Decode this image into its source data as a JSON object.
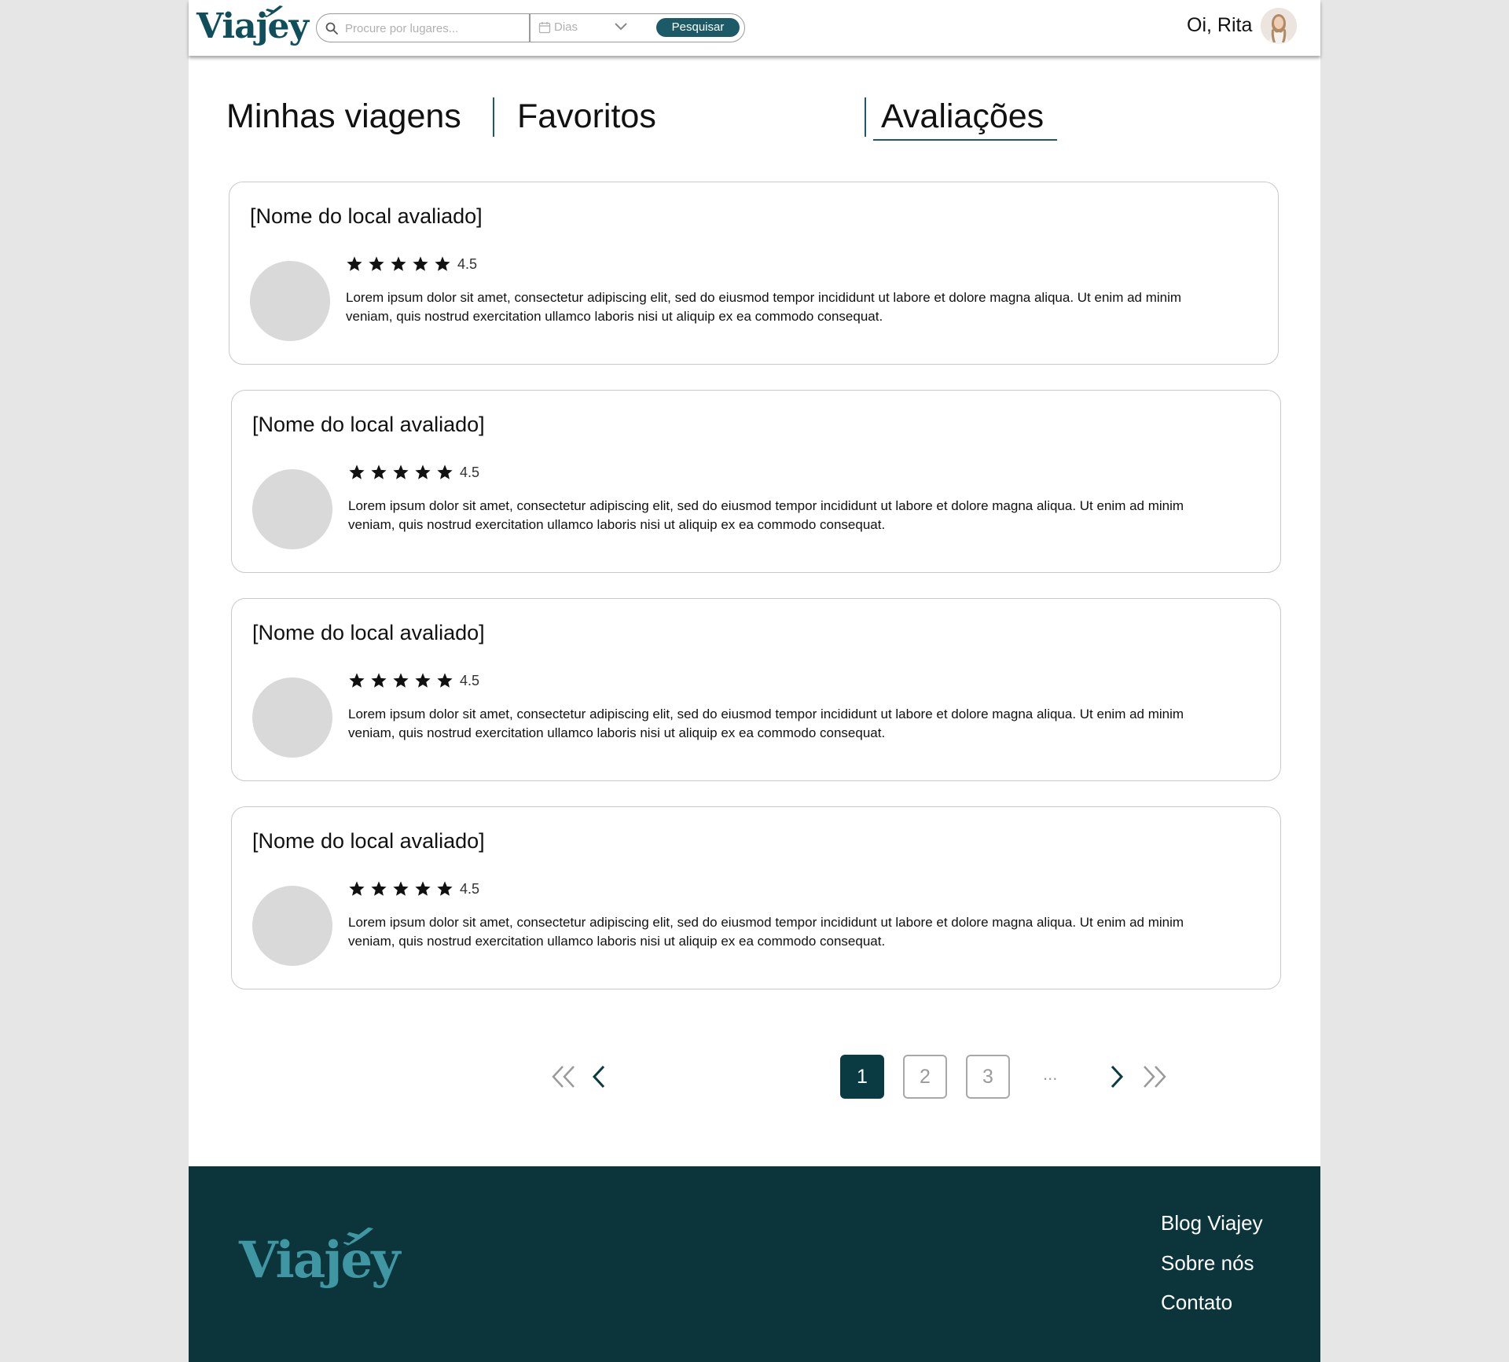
{
  "brand": {
    "name": "Viajey"
  },
  "header": {
    "search_placeholder": "Procure por lugares...",
    "days_label": "Dias",
    "search_button": "Pesquisar",
    "greeting": "Oi, Rita"
  },
  "tabs": [
    {
      "label": "Minhas viagens",
      "active": false
    },
    {
      "label": "Favoritos",
      "active": false
    },
    {
      "label": "Avaliações",
      "active": true
    }
  ],
  "reviews": [
    {
      "title": "[Nome do local avaliado]",
      "stars": 5,
      "rating": "4.5",
      "text": "Lorem ipsum dolor sit amet, consectetur adipiscing elit, sed do eiusmod tempor incididunt ut labore et dolore magna aliqua. Ut enim ad minim veniam, quis nostrud exercitation ullamco laboris nisi ut aliquip ex ea commodo consequat."
    },
    {
      "title": "[Nome do local avaliado]",
      "stars": 5,
      "rating": "4.5",
      "text": "Lorem ipsum dolor sit amet, consectetur adipiscing elit, sed do eiusmod tempor incididunt ut labore et dolore magna aliqua. Ut enim ad minim veniam, quis nostrud exercitation ullamco laboris nisi ut aliquip ex ea commodo consequat."
    },
    {
      "title": "[Nome do local avaliado]",
      "stars": 5,
      "rating": "4.5",
      "text": "Lorem ipsum dolor sit amet, consectetur adipiscing elit, sed do eiusmod tempor incididunt ut labore et dolore magna aliqua. Ut enim ad minim veniam, quis nostrud exercitation ullamco laboris nisi ut aliquip ex ea commodo consequat."
    },
    {
      "title": "[Nome do local avaliado]",
      "stars": 5,
      "rating": "4.5",
      "text": "Lorem ipsum dolor sit amet, consectetur adipiscing elit, sed do eiusmod tempor incididunt ut labore et dolore magna aliqua. Ut enim ad minim veniam, quis nostrud exercitation ullamco laboris nisi ut aliquip ex ea commodo consequat."
    }
  ],
  "pagination": {
    "pages": [
      "1",
      "2",
      "3"
    ],
    "current": "1",
    "ellipsis": "..."
  },
  "footer": {
    "links": [
      "Blog Viajey",
      "Sobre nós",
      "Contato"
    ]
  },
  "colors": {
    "brand_teal": "#0f4f5c",
    "button": "#1b5a66",
    "footer_bg": "#0b343b",
    "footer_logo": "#3f97a3",
    "active_page": "#0b3b42"
  },
  "icons": {
    "search": "search-icon",
    "calendar": "calendar-icon",
    "dropdown": "chevron-down-icon",
    "star": "star-icon",
    "first_page": "double-chevron-left-icon",
    "prev_page": "chevron-left-icon",
    "next_page": "chevron-right-icon",
    "last_page": "double-chevron-right-icon",
    "plane": "airplane-icon"
  }
}
